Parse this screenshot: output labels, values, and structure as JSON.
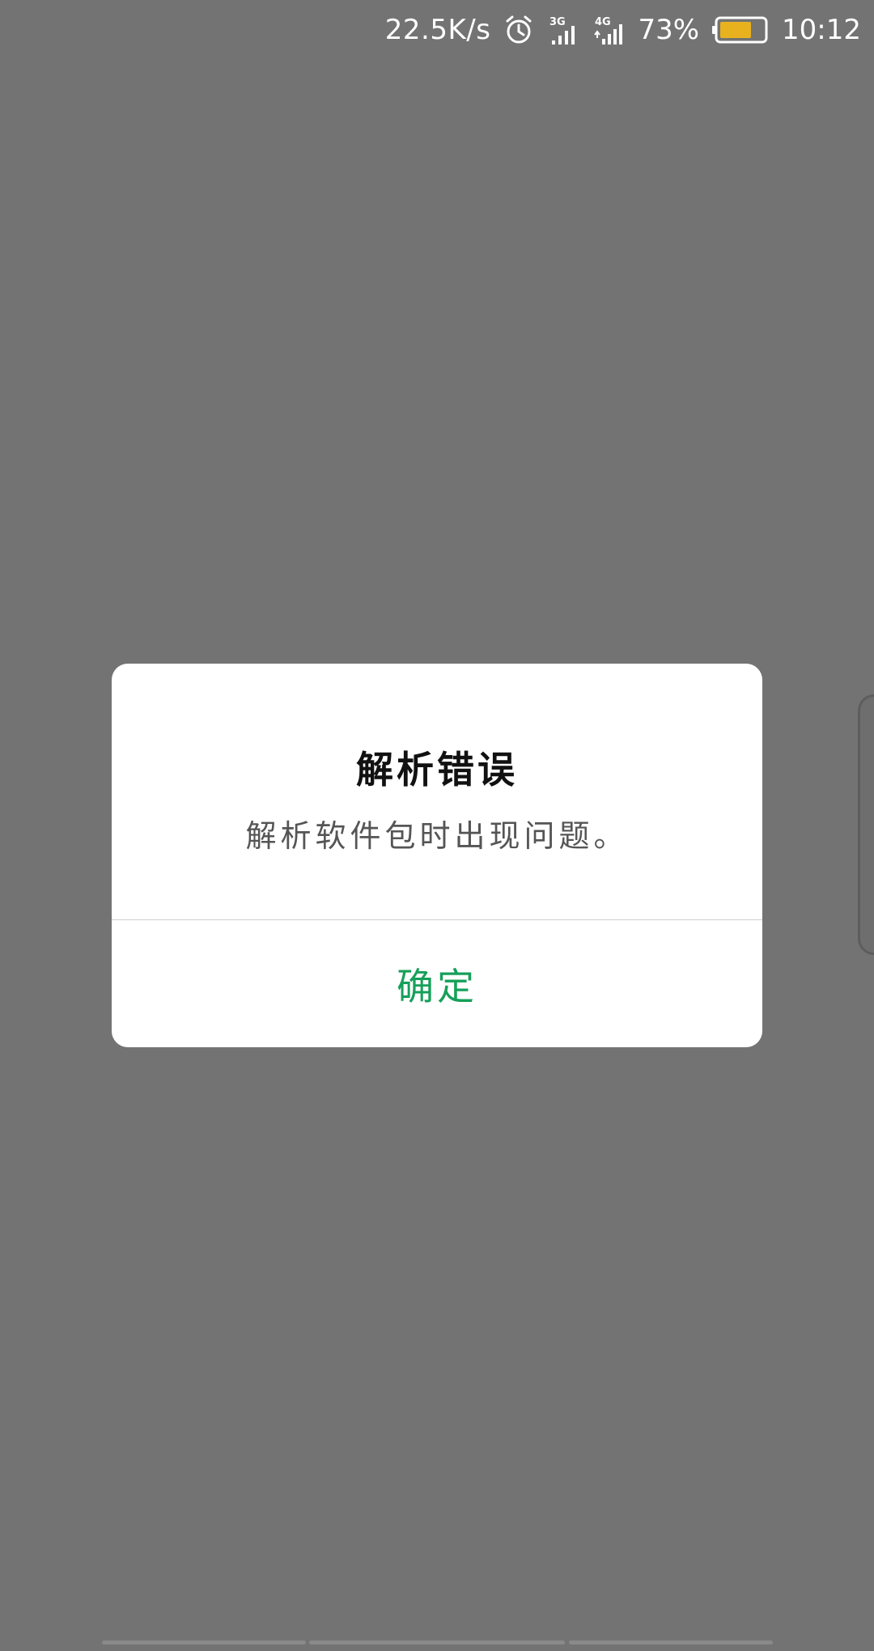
{
  "status_bar": {
    "net_speed": "22.5K/s",
    "alarm_icon": "alarm-clock-icon",
    "signal_3g_label": "3G",
    "signal_4g_label": "4G",
    "battery_percent": "73%",
    "battery_level": 0.73,
    "battery_color": "#e8b21e",
    "time": "10:12"
  },
  "dialog": {
    "title": "解析错误",
    "message": "解析软件包时出现问题。",
    "ok_label": "确定",
    "accent_color": "#16a05a"
  }
}
